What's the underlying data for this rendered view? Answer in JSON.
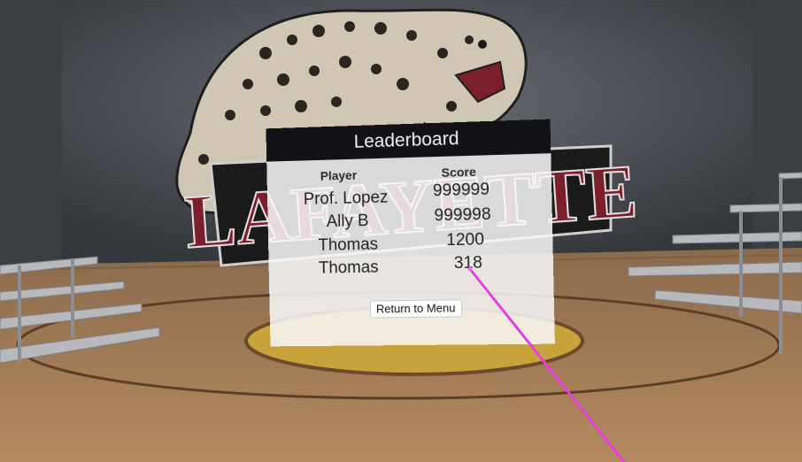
{
  "scene": {
    "wall_sign_text": "LAFAYETTE",
    "colors": {
      "wall": "#4a4d53",
      "floor": "#9a7450",
      "court_circle": "#c8a23a",
      "logo_maroon": "#7a1f2b",
      "pointer": "#e83ee0"
    }
  },
  "leaderboard": {
    "title": "Leaderboard",
    "columns": {
      "player": "Player",
      "score": "Score"
    },
    "rows": [
      {
        "player": "Prof. Lopez",
        "score": "999999"
      },
      {
        "player": "Ally B",
        "score": "999998"
      },
      {
        "player": "Thomas",
        "score": "1200"
      },
      {
        "player": "Thomas",
        "score": "318"
      }
    ],
    "return_button": "Return to Menu"
  }
}
